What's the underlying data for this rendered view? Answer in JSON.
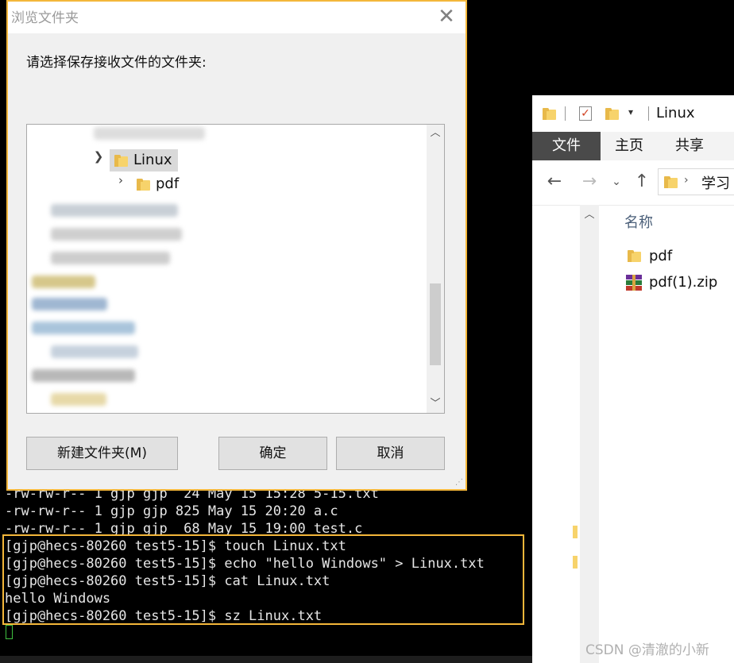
{
  "terminal": {
    "lines": [
      "-rw-rw-r-- 1 gjp gjp  24 May 15 15:28 5-15.txt",
      "-rw-rw-r-- 1 gjp gjp 825 May 15 20:20 a.c",
      "-rw-rw-r-- 1 gjp gjp  68 May 15 19:00 test.c",
      "[gjp@hecs-80260 test5-15]$ touch Linux.txt",
      "[gjp@hecs-80260 test5-15]$ echo \"hello Windows\" > Linux.txt",
      "[gjp@hecs-80260 test5-15]$ cat Linux.txt",
      "hello Windows",
      "[gjp@hecs-80260 test5-15]$ sz Linux.txt"
    ],
    "highlight_color": "#f4b73a"
  },
  "dialog": {
    "title": "浏览文件夹",
    "close_glyph": "✕",
    "prompt": "请选择保存接收文件的文件夹:",
    "tree": {
      "selected_folder": "Linux",
      "child_folder": "pdf"
    },
    "buttons": {
      "new_folder": "新建文件夹(M)",
      "ok": "确定",
      "cancel": "取消"
    }
  },
  "explorer": {
    "title": "Linux",
    "tabs": [
      "文件",
      "主页",
      "共享"
    ],
    "address_segment": "学习",
    "column_header": "名称",
    "files": [
      {
        "name": "pdf",
        "icon": "folder-icon"
      },
      {
        "name": "pdf(1).zip",
        "icon": "zip-archive-icon"
      }
    ]
  },
  "watermark": "CSDN @清澈的小新",
  "colors": {
    "accent_border": "#f4b73a",
    "ribbon_active": "#4a4a4a",
    "folder": "#f7d36b"
  }
}
